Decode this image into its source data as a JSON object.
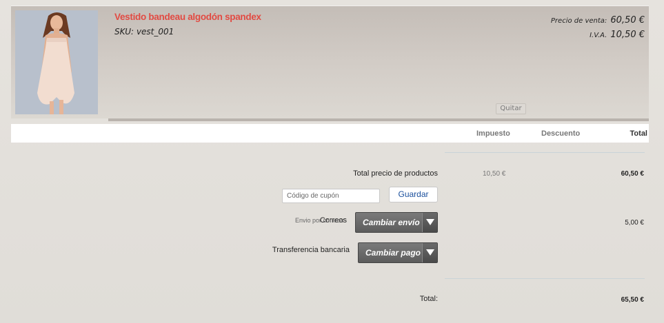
{
  "product": {
    "name": "Vestido bandeau algodón spandex",
    "sku_label": "SKU:",
    "sku": "vest_001",
    "price_label": "Precio de venta:",
    "price": "60,50 €",
    "tax_label": "I.V.A.",
    "tax": "10,50 €",
    "remove_label": "Quitar",
    "image_icon": "dress-photo"
  },
  "columns": {
    "tax": "Impuesto",
    "discount": "Descuento",
    "total": "Total"
  },
  "summary": {
    "products_label": "Total precio de productos",
    "products_tax": "10,50 €",
    "products_total": "60,50 €",
    "coupon_placeholder": "Código de cupón",
    "save_label": "Guardar",
    "shipping_label": "Correos",
    "shipping_sub": "Envio por correos",
    "change_shipping": "Cambiar envío",
    "shipping_total": "5,00 €",
    "payment_label": "Transferencia bancaria",
    "change_payment": "Cambiar pago",
    "grand_label": "Total:",
    "grand_total": "65,50 €"
  },
  "colors": {
    "product_name": "#e24a42",
    "save_text": "#1a4f9c"
  }
}
